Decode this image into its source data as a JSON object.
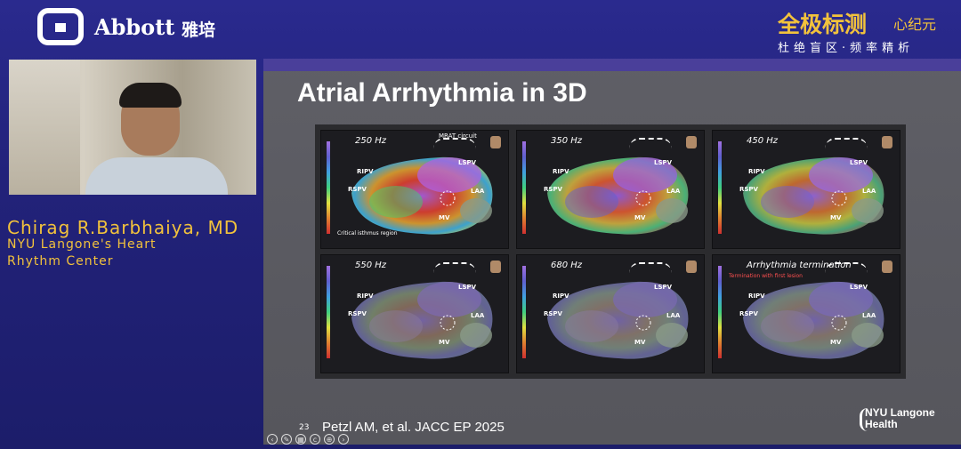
{
  "header": {
    "brand": "Abbott",
    "brand_cn": "雅培",
    "headline_cn": "全极标测",
    "headline_cn_small": "心纪元",
    "subtitle_cn": "杜绝盲区·频率精析"
  },
  "speaker": {
    "name": "Chirag R.Barbhaiya, MD",
    "affiliation_line1": "NYU Langone's Heart",
    "affiliation_line2": "Rhythm Center"
  },
  "slide": {
    "title": "Atrial Arrhythmia in 3D",
    "page_number": "23",
    "citation": "Petzl AM, et al.  JACC EP 2025",
    "logo_line1": "NYU Langone",
    "logo_line2": "Health",
    "panels": [
      {
        "freq": "250 Hz",
        "extra_label": "MRAT circuit",
        "note": "Critical isthmus region"
      },
      {
        "freq": "350 Hz"
      },
      {
        "freq": "450 Hz"
      },
      {
        "freq": "550 Hz"
      },
      {
        "freq": "680 Hz"
      },
      {
        "freq": "Arrhythmia termination",
        "note": "Termination with first lesion"
      }
    ],
    "anatomy": {
      "ripv": "RIPV",
      "rspv": "RSPV",
      "lspv": "LSPV",
      "laa": "LAA",
      "mv": "MV"
    }
  },
  "toolbar": [
    "prev-icon",
    "pen-icon",
    "grid-icon",
    "cc-icon",
    "zoom-icon",
    "next-icon"
  ],
  "colors": {
    "background": "#22227a",
    "accent": "#f2c23c",
    "slide_bg": "#5b5b62"
  }
}
